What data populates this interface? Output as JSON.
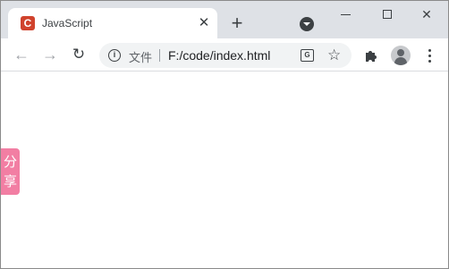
{
  "browser": {
    "tab": {
      "title": "JavaScript",
      "favicon_letter": "C",
      "favicon_color": "#d0432d",
      "close_glyph": "✕"
    },
    "new_tab_glyph": "+",
    "window_controls": {
      "close_glyph": "✕"
    },
    "toolbar": {
      "back_glyph": "←",
      "forward_glyph": "→",
      "reload_glyph": "↻"
    },
    "omnibox": {
      "info_glyph": "i",
      "file_label": "文件",
      "url": "F:/code/index.html",
      "translate_glyph": "G",
      "star_glyph": "☆"
    }
  },
  "page": {
    "share_button": {
      "chars": [
        "分",
        "享"
      ],
      "color": "#f27ea3"
    }
  }
}
